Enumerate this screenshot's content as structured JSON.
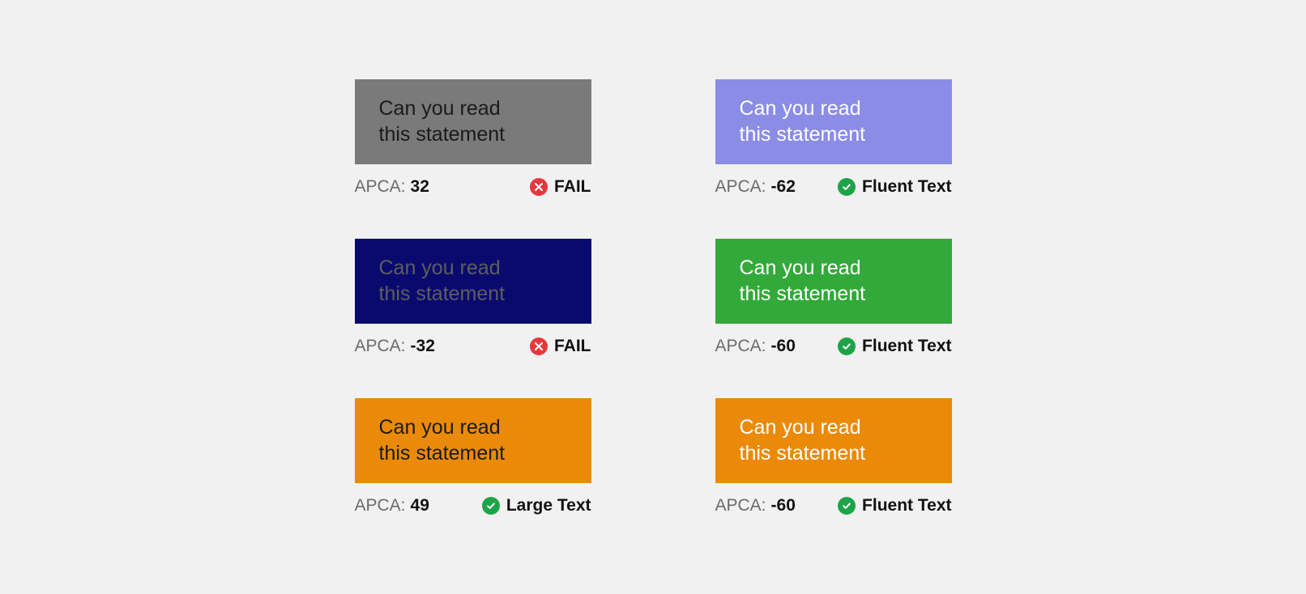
{
  "sample_line1": "Can you read",
  "sample_line2": "this statement",
  "apca_label": "APCA:",
  "cards": [
    {
      "bg": "#7a7a7a",
      "fg": "#1a1a1a",
      "apca": "32",
      "status_kind": "fail",
      "status_label": "FAIL"
    },
    {
      "bg": "#8a8ce6",
      "fg": "#ffffff",
      "apca": "-62",
      "status_kind": "pass",
      "status_label": "Fluent Text"
    },
    {
      "bg": "#0a0a6e",
      "fg": "#5e5e5e",
      "apca": "-32",
      "status_kind": "fail",
      "status_label": "FAIL"
    },
    {
      "bg": "#32a93a",
      "fg": "#ffffff",
      "apca": "-60",
      "status_kind": "pass",
      "status_label": "Fluent Text"
    },
    {
      "bg": "#ea8a08",
      "fg": "#1a1a1a",
      "apca": "49",
      "status_kind": "pass",
      "status_label": "Large Text"
    },
    {
      "bg": "#ea8a08",
      "fg": "#ffffff",
      "apca": "-60",
      "status_kind": "pass",
      "status_label": "Fluent Text"
    }
  ]
}
